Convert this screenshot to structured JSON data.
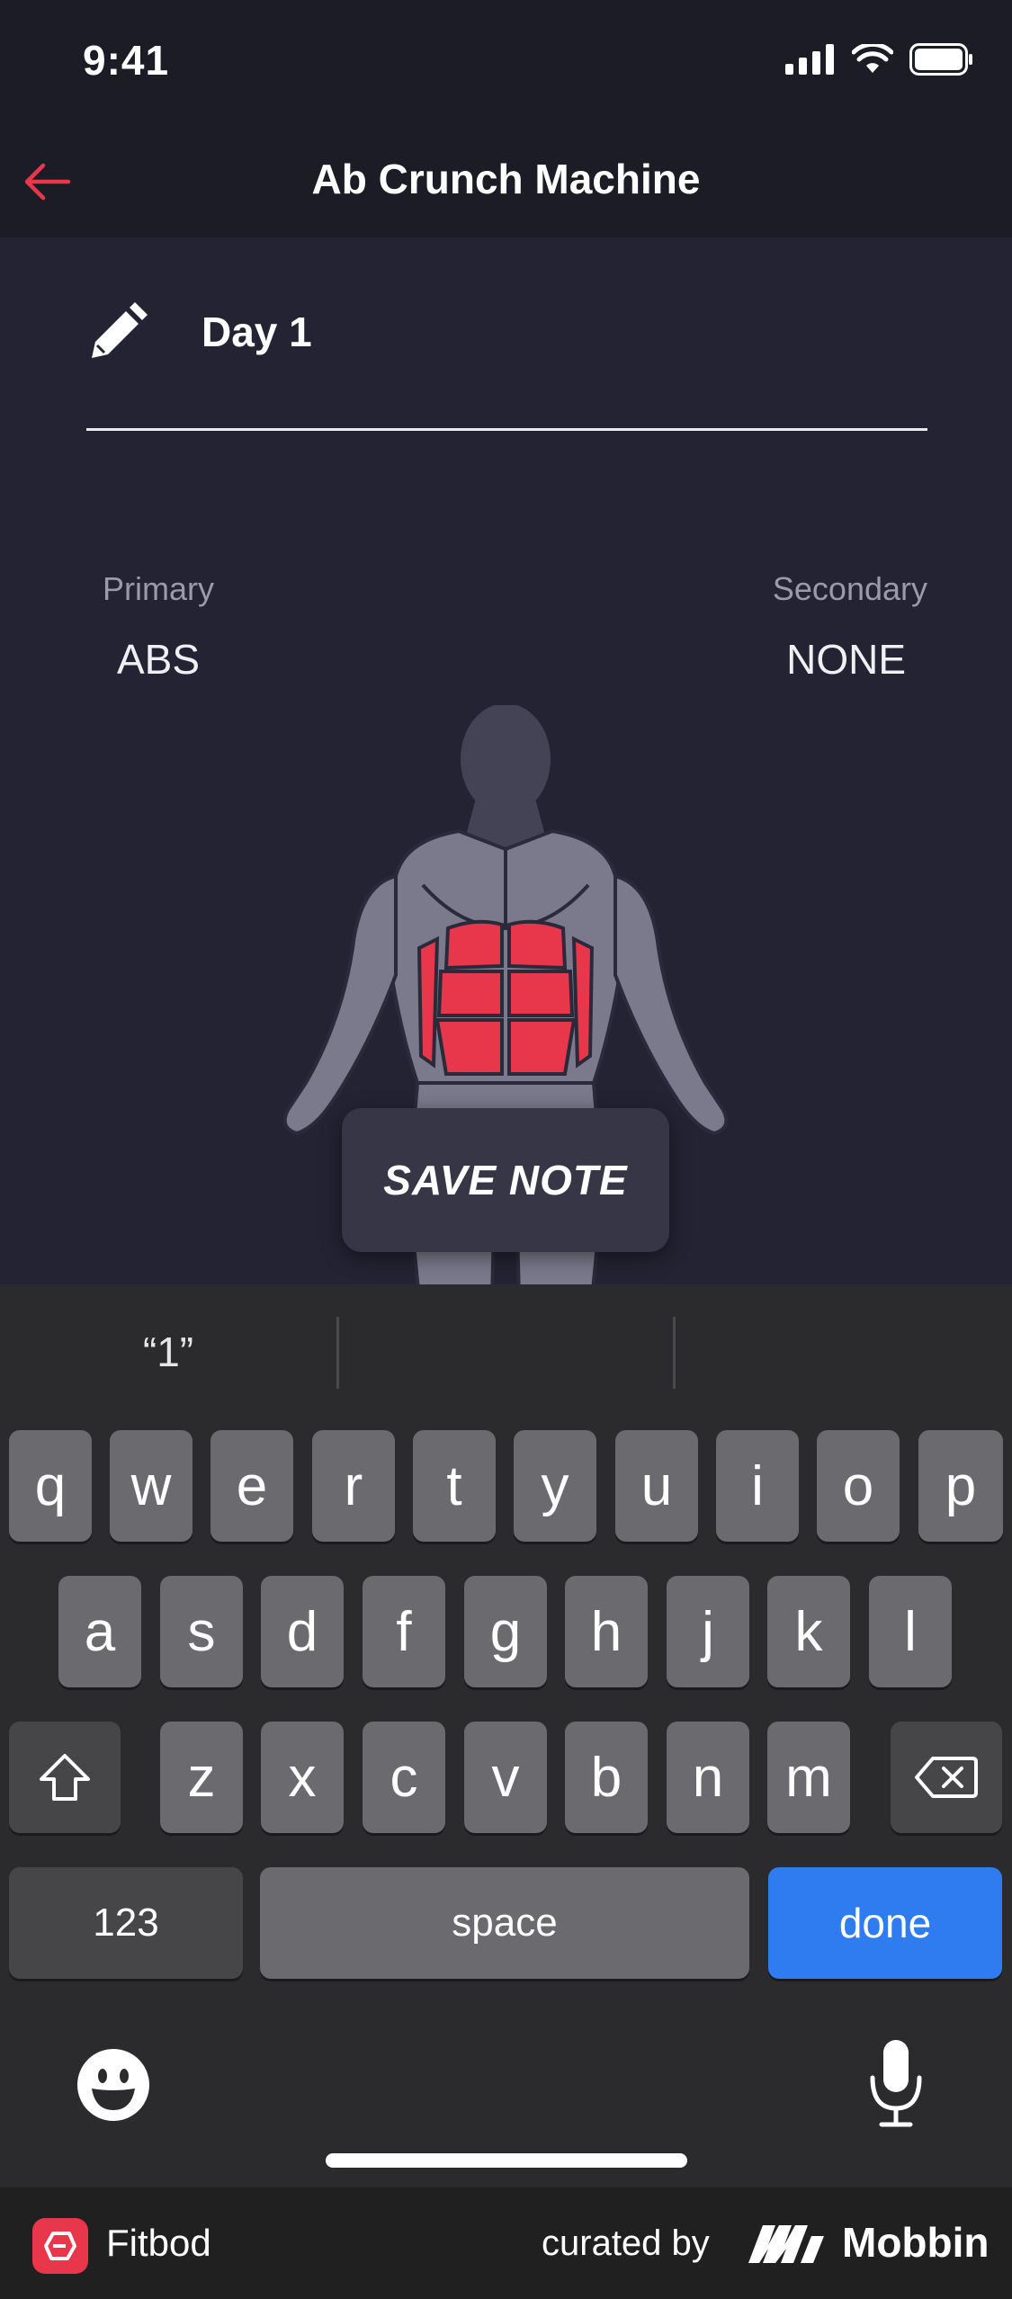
{
  "status_bar": {
    "time": "9:41"
  },
  "nav": {
    "title": "Ab Crunch Machine"
  },
  "note": {
    "value": "Day 1"
  },
  "muscles": {
    "primary_label": "Primary",
    "primary_value": "ABS",
    "secondary_label": "Secondary",
    "secondary_value": "NONE"
  },
  "save_button": {
    "label": "SAVE NOTE"
  },
  "keyboard": {
    "suggestions": [
      "“1”",
      "",
      ""
    ],
    "row1": [
      "q",
      "w",
      "e",
      "r",
      "t",
      "y",
      "u",
      "i",
      "o",
      "p"
    ],
    "row2": [
      "a",
      "s",
      "d",
      "f",
      "g",
      "h",
      "j",
      "k",
      "l"
    ],
    "row3": [
      "z",
      "x",
      "c",
      "v",
      "b",
      "n",
      "m"
    ],
    "numbers_label": "123",
    "space_label": "space",
    "done_label": "done"
  },
  "footer": {
    "app_name": "Fitbod",
    "curated_label": "curated by",
    "brand_name": "Mobbin"
  },
  "colors": {
    "accent_red": "#e8374b",
    "done_blue": "#2f7cf0",
    "background": "#232333"
  },
  "icons": {
    "back": "arrow-left-icon",
    "pencil": "pencil-icon",
    "shift": "shift-icon",
    "delete": "backspace-icon",
    "emoji": "emoji-icon",
    "mic": "microphone-icon"
  }
}
